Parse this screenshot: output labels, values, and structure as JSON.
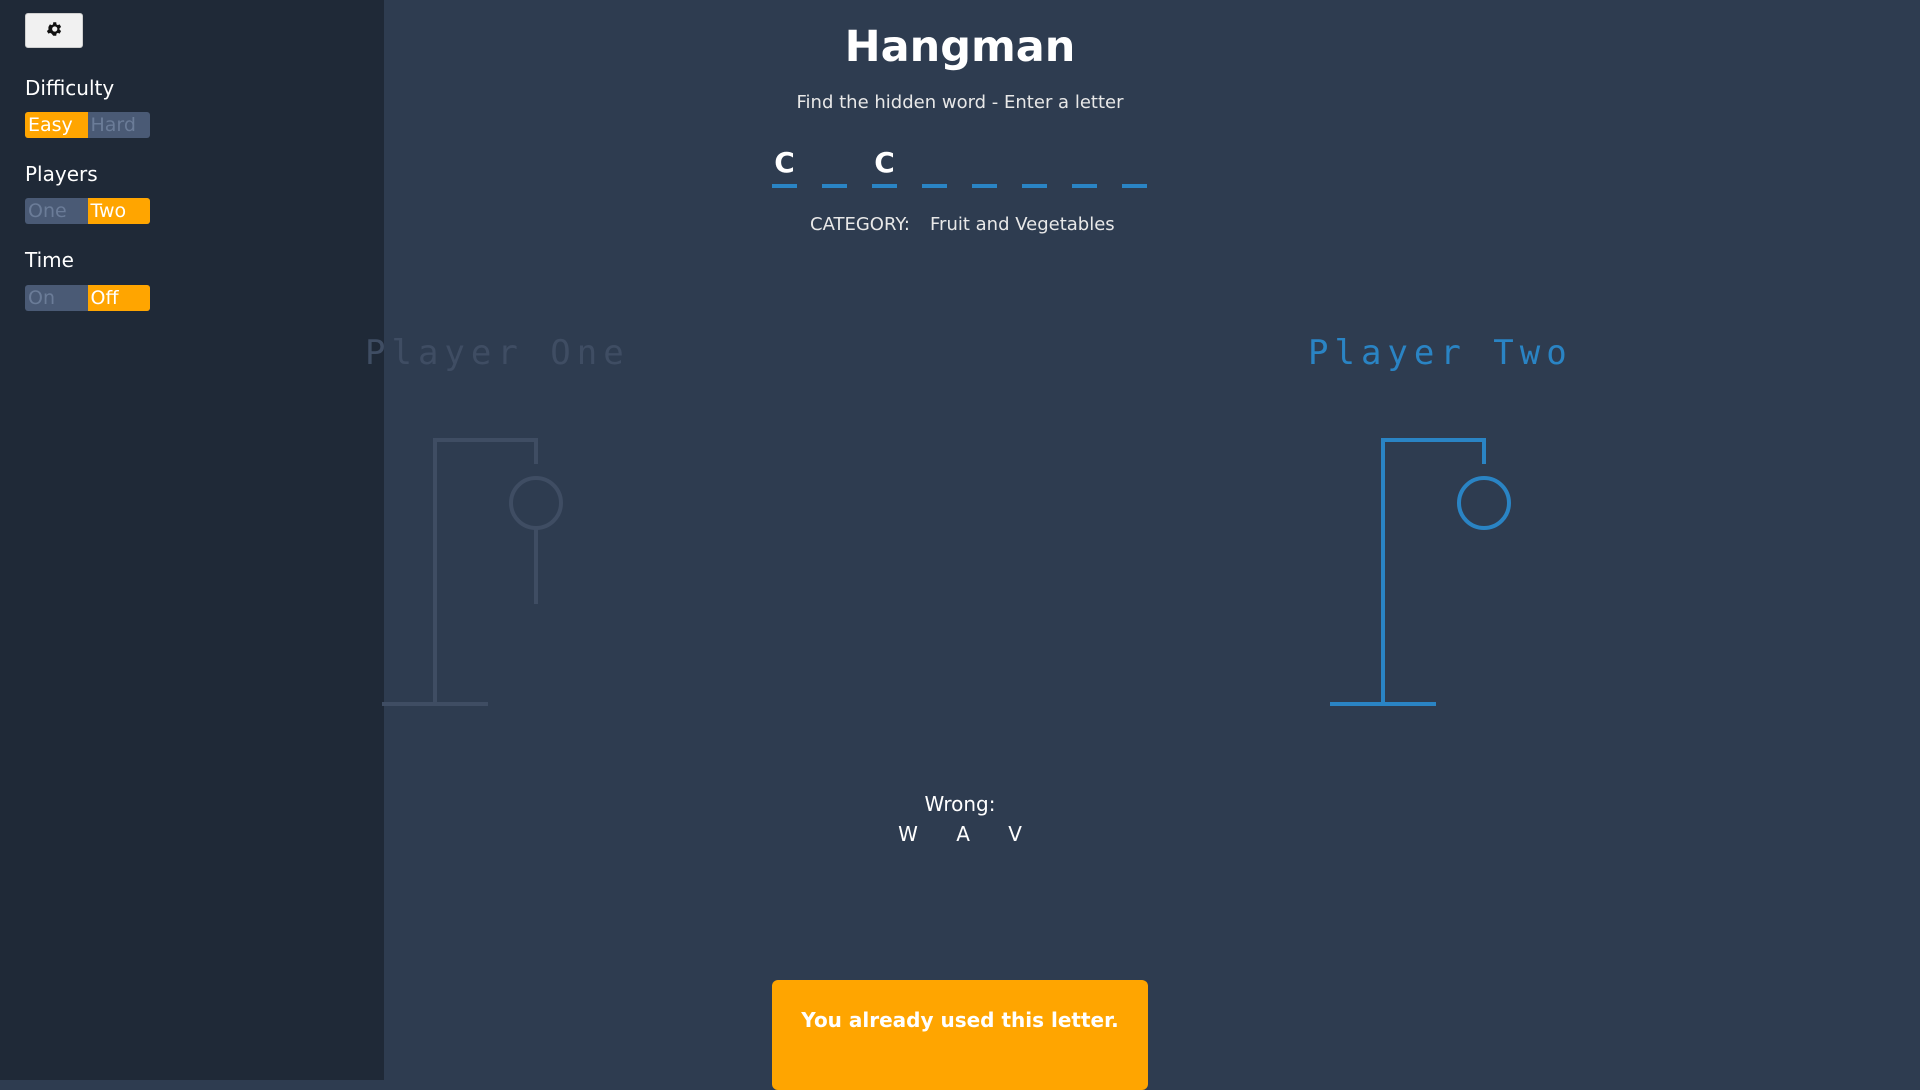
{
  "settings": {
    "button_icon": "gear-icon"
  },
  "difficulty": {
    "label": "Difficulty",
    "options": [
      "Easy",
      "Hard"
    ],
    "selected": "Easy"
  },
  "players": {
    "label": "Players",
    "options": [
      "One",
      "Two"
    ],
    "selected": "Two"
  },
  "time": {
    "label": "Time",
    "options": [
      "On",
      "Off"
    ],
    "selected": "Off"
  },
  "game": {
    "title": "Hangman",
    "subtitle": "Find the hidden word - Enter a letter",
    "word_slots": [
      "C",
      "",
      "C",
      "",
      "",
      "",
      "",
      ""
    ],
    "category_label": "CATEGORY:",
    "category_value": "Fruit and Vegetables"
  },
  "player_one": {
    "label": "Player One",
    "wrong_count": 2
  },
  "player_two": {
    "label": "Player Two",
    "wrong_count": 1,
    "active": true
  },
  "wrong": {
    "label": "Wrong:",
    "letters": [
      "W",
      "A",
      "V"
    ]
  },
  "toast": {
    "message": "You already used this letter."
  },
  "colors": {
    "accent": "#ffa500",
    "active_player": "#2a84c4",
    "inactive_player": "#3f4d63",
    "background": "#2e3c50",
    "sidebar": "#1f2937"
  }
}
